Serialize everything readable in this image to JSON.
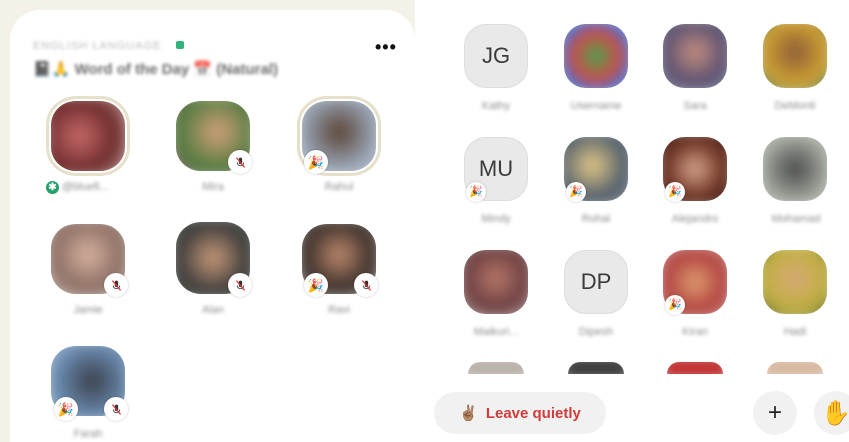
{
  "stage": {
    "subtitle": "ENGLISH LANGUAGE",
    "title": "Word of the Day",
    "more_label": "•••",
    "speakers": [
      {
        "name": "@bluefi...",
        "badge": "",
        "live": true
      },
      {
        "name": "Mira",
        "badge": "mute"
      },
      {
        "name": "Rahul",
        "badge": "party"
      },
      {
        "name": "Jamie",
        "badge": "mute"
      },
      {
        "name": "Alan",
        "badge": "mute"
      },
      {
        "name": "Ravi",
        "badge": "party+mute"
      },
      {
        "name": "Farah",
        "badge": "party+mute"
      }
    ]
  },
  "audience": {
    "members": [
      {
        "name": "Kathy",
        "initials": "JG"
      },
      {
        "name": "Username",
        "initials": ""
      },
      {
        "name": "Sara",
        "initials": ""
      },
      {
        "name": "DeMonti",
        "initials": ""
      },
      {
        "name": "Mindy",
        "initials": "MU"
      },
      {
        "name": "Rohal",
        "initials": ""
      },
      {
        "name": "Alejandro",
        "initials": ""
      },
      {
        "name": "Mohamad",
        "initials": ""
      },
      {
        "name": "Maikuri...",
        "initials": ""
      },
      {
        "name": "Dipesh",
        "initials": "DP"
      },
      {
        "name": "Kiran",
        "initials": ""
      },
      {
        "name": "Hadi",
        "initials": ""
      }
    ]
  },
  "controls": {
    "leave_label": "Leave quietly",
    "leave_emoji": "✌🏽",
    "add_label": "+",
    "hand_label": "✋"
  }
}
